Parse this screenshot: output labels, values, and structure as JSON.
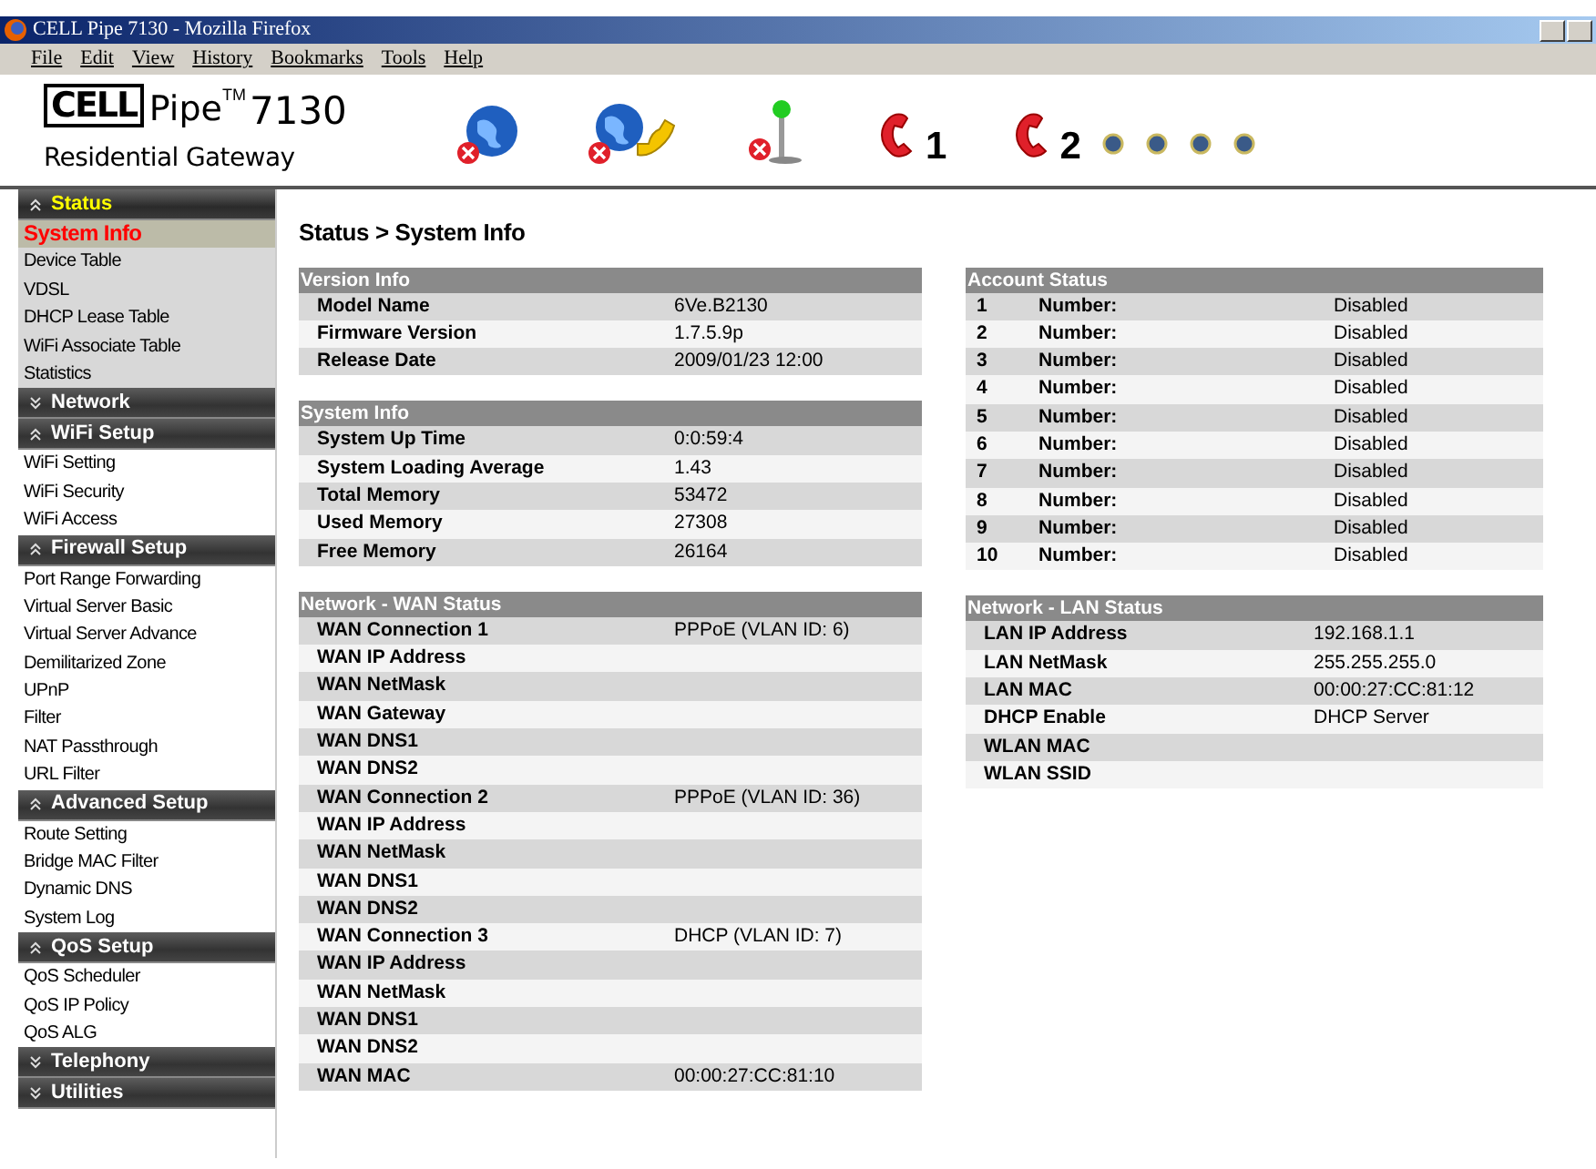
{
  "window": {
    "title": "CELL Pipe 7130 - Mozilla Firefox"
  },
  "menu": [
    "File",
    "Edit",
    "View",
    "History",
    "Bookmarks",
    "Tools",
    "Help"
  ],
  "logo": {
    "brand_boxed": "CELL",
    "brand": "Pipe",
    "trademark": "TM",
    "model": "7130",
    "subtitle": "Residential Gateway"
  },
  "status_icons": [
    {
      "kind": "globe",
      "error": true
    },
    {
      "kind": "globe-phone",
      "error": true
    },
    {
      "kind": "antenna",
      "error": true
    },
    {
      "kind": "phone",
      "error": false,
      "label": "1"
    },
    {
      "kind": "phone",
      "error": false,
      "label": "2"
    },
    {
      "kind": "led"
    },
    {
      "kind": "led"
    },
    {
      "kind": "led"
    },
    {
      "kind": "led"
    }
  ],
  "sidebar": [
    {
      "title": "Status",
      "expanded": true,
      "active": true,
      "items": [
        {
          "label": "System Info",
          "selected": true
        },
        {
          "label": "Device Table",
          "selected": false
        },
        {
          "label": "VDSL",
          "selected": false
        },
        {
          "label": "DHCP Lease Table",
          "selected": false
        },
        {
          "label": "WiFi Associate Table",
          "selected": false
        },
        {
          "label": "Statistics",
          "selected": false
        }
      ]
    },
    {
      "title": "Network",
      "expanded": false,
      "active": false
    },
    {
      "title": "WiFi Setup",
      "expanded": true,
      "active": false,
      "items": [
        {
          "label": "WiFi Setting",
          "selected": false
        },
        {
          "label": "WiFi Security",
          "selected": false
        },
        {
          "label": "WiFi Access",
          "selected": false
        }
      ]
    },
    {
      "title": "Firewall Setup",
      "expanded": true,
      "active": false,
      "items": [
        {
          "label": "Port Range Forwarding",
          "selected": false
        },
        {
          "label": "Virtual Server Basic",
          "selected": false
        },
        {
          "label": "Virtual Server Advance",
          "selected": false
        },
        {
          "label": "Demilitarized Zone",
          "selected": false
        },
        {
          "label": "UPnP",
          "selected": false
        },
        {
          "label": "Filter",
          "selected": false
        },
        {
          "label": "NAT Passthrough",
          "selected": false
        },
        {
          "label": "URL Filter",
          "selected": false
        }
      ]
    },
    {
      "title": "Advanced Setup",
      "expanded": true,
      "active": false,
      "items": [
        {
          "label": "Route Setting",
          "selected": false
        },
        {
          "label": "Bridge MAC Filter",
          "selected": false
        },
        {
          "label": "Dynamic DNS",
          "selected": false
        },
        {
          "label": "System Log",
          "selected": false
        }
      ]
    },
    {
      "title": "QoS Setup",
      "expanded": true,
      "active": false,
      "items": [
        {
          "label": "QoS Scheduler",
          "selected": false
        },
        {
          "label": "QoS IP Policy",
          "selected": false
        },
        {
          "label": "QoS ALG",
          "selected": false
        }
      ]
    },
    {
      "title": "Telephony",
      "expanded": false,
      "active": false
    },
    {
      "title": "Utilities",
      "expanded": false,
      "active": false
    }
  ],
  "page_title": "Status > System Info",
  "left_tables": [
    {
      "title": "Version Info",
      "rows": [
        {
          "label": "Model Name",
          "value": "6Ve.B2130"
        },
        {
          "label": "Firmware Version",
          "value": "1.7.5.9p"
        },
        {
          "label": "Release Date",
          "value": "2009/01/23 12:00"
        }
      ]
    },
    {
      "title": "System Info",
      "rows": [
        {
          "label": "System Up Time",
          "value": "0:0:59:4"
        },
        {
          "label": "System Loading Average",
          "value": "1.43"
        },
        {
          "label": "Total Memory",
          "value": "53472"
        },
        {
          "label": "Used Memory",
          "value": "27308"
        },
        {
          "label": "Free Memory",
          "value": "26164"
        }
      ]
    },
    {
      "title": "Network - WAN Status",
      "rows": [
        {
          "label": "WAN Connection 1",
          "value": "PPPoE (VLAN ID: 6)"
        },
        {
          "label": "WAN IP Address"
        },
        {
          "label": "WAN NetMask"
        },
        {
          "label": "WAN Gateway"
        },
        {
          "label": "WAN DNS1"
        },
        {
          "label": "WAN DNS2"
        },
        {
          "label": "WAN Connection  2",
          "value": "PPPoE (VLAN ID: 36)"
        },
        {
          "label": "WAN IP Address"
        },
        {
          "label": "WAN NetMask"
        },
        {
          "label": "WAN DNS1"
        },
        {
          "label": "WAN DNS2"
        },
        {
          "label": "WAN Connection  3",
          "value": "DHCP (VLAN ID: 7)"
        },
        {
          "label": "WAN IP Address"
        },
        {
          "label": "WAN NetMask"
        },
        {
          "label": "WAN DNS1"
        },
        {
          "label": "WAN DNS2"
        },
        {
          "label": "WAN MAC",
          "value": "00:00:27:CC:81:10"
        }
      ]
    }
  ],
  "account_status": {
    "title": "Account Status",
    "rows": [
      {
        "index": "1",
        "label": "Number:",
        "value": "Disabled"
      },
      {
        "index": "2",
        "label": "Number:",
        "value": "Disabled"
      },
      {
        "index": "3",
        "label": "Number:",
        "value": "Disabled"
      },
      {
        "index": "4",
        "label": "Number:",
        "value": "Disabled"
      },
      {
        "index": "5",
        "label": "Number:",
        "value": "Disabled"
      },
      {
        "index": "6",
        "label": "Number:",
        "value": "Disabled"
      },
      {
        "index": "7",
        "label": "Number:",
        "value": "Disabled"
      },
      {
        "index": "8",
        "label": "Number:",
        "value": "Disabled"
      },
      {
        "index": "9",
        "label": "Number:",
        "value": "Disabled"
      },
      {
        "index": "10",
        "label": "Number:",
        "value": "Disabled"
      }
    ]
  },
  "lan_status": {
    "title": "Network - LAN Status",
    "rows": [
      {
        "label": "LAN IP Address",
        "value": "192.168.1.1"
      },
      {
        "label": "LAN NetMask",
        "value": "255.255.255.0"
      },
      {
        "label": "LAN MAC",
        "value": "00:00:27:CC:81:12"
      },
      {
        "label": "DHCP Enable",
        "value": "DHCP Server"
      },
      {
        "label": "WLAN MAC"
      },
      {
        "label": "WLAN SSID"
      }
    ]
  }
}
